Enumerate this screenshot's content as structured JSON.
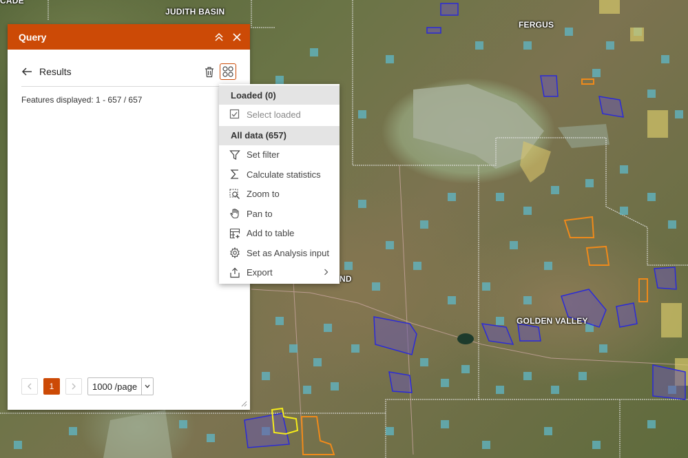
{
  "map": {
    "labels": {
      "judith_basin": "JUDITH BASIN",
      "fergus": "FERGUS",
      "golden_valley": "GOLDEN VALLEY",
      "cascade": "CADE",
      "wheatland": "ND"
    }
  },
  "panel": {
    "title": "Query",
    "results_title": "Results",
    "features_displayed": "Features displayed: 1 - 657 / 657",
    "pager": {
      "current_page": "1",
      "page_size": "1000 /page"
    }
  },
  "menu": {
    "loaded_header": "Loaded (0)",
    "select_loaded": "Select loaded",
    "all_data_header": "All data (657)",
    "items": [
      {
        "label": "Set filter",
        "icon": "filter-icon"
      },
      {
        "label": "Calculate statistics",
        "icon": "sigma-icon"
      },
      {
        "label": "Zoom to",
        "icon": "zoom-to-icon"
      },
      {
        "label": "Pan to",
        "icon": "hand-icon"
      },
      {
        "label": "Add to table",
        "icon": "table-add-icon"
      },
      {
        "label": "Set as Analysis input",
        "icon": "gear-icon"
      },
      {
        "label": "Export",
        "icon": "export-icon"
      }
    ]
  },
  "colors": {
    "accent": "#cc4a06",
    "parcel_blue": "#2a2ad8",
    "parcel_orange": "#f08a1a",
    "parcel_yellow": "#f5ec1a",
    "grid_cyan": "#5fb8c8"
  }
}
